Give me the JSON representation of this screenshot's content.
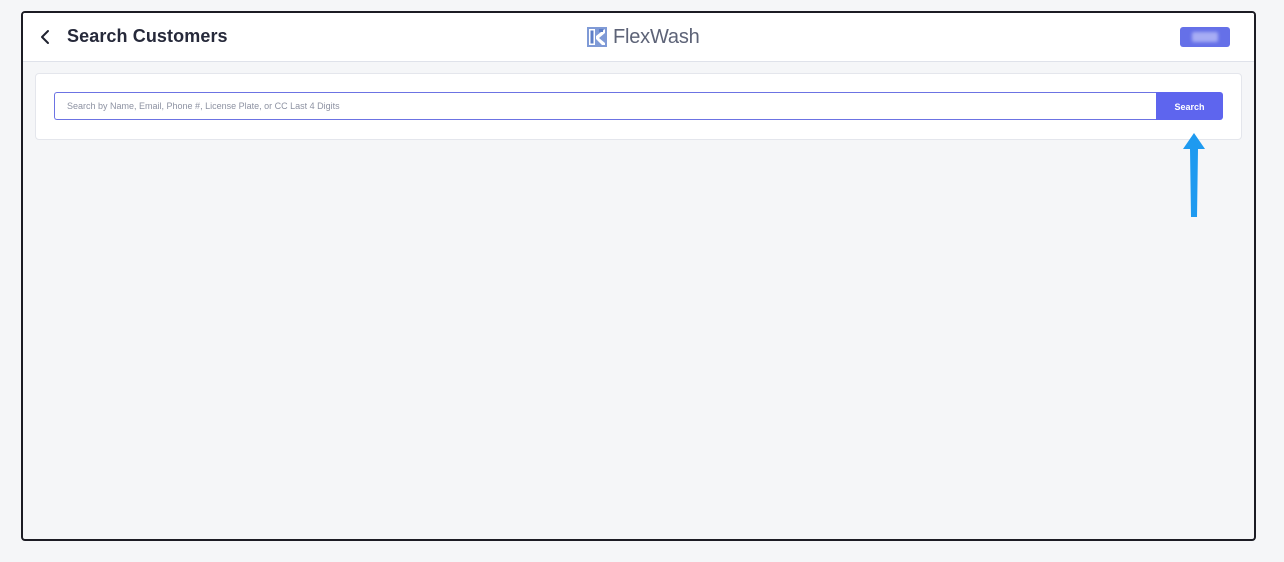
{
  "header": {
    "title": "Search Customers",
    "back_icon": "chevron-left-icon",
    "brand_name": "FlexWash",
    "brand_icon": "flexwash-logo-icon",
    "user_chip_color": "#6570e8"
  },
  "search": {
    "placeholder": "Search by Name, Email, Phone #, License Plate, or CC Last 4 Digits",
    "value": "",
    "button_label": "Search"
  },
  "colors": {
    "accent": "#5e65ee",
    "annotation_arrow": "#1e9af0",
    "page_background": "#f5f6f8"
  }
}
